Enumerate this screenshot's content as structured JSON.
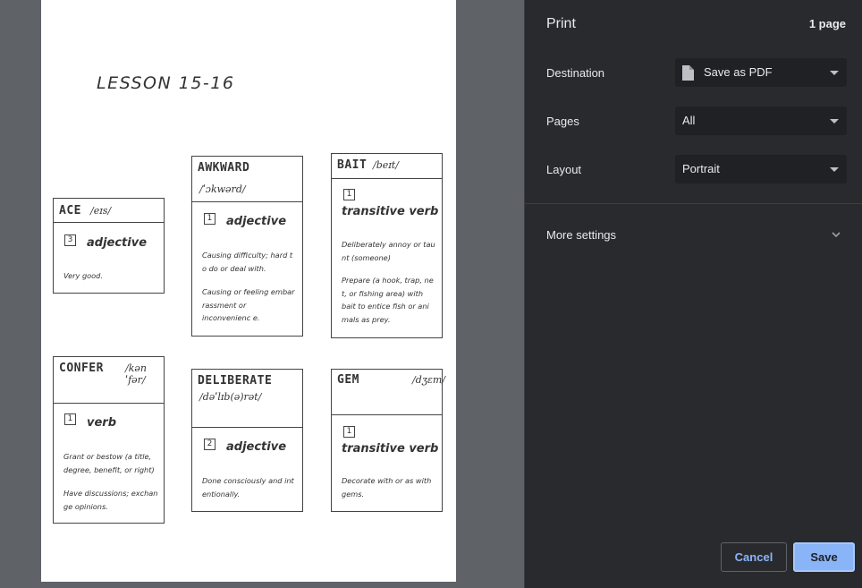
{
  "preview": {
    "lesson_title": "LESSON 15-16",
    "cards": [
      {
        "word": "ACE",
        "ipa": "/eɪs/",
        "number": "3",
        "part_of_speech": "adjective",
        "definitions": [
          "Very good."
        ]
      },
      {
        "word": "AWKWARD",
        "ipa": "/ˈɔkwərd/",
        "number": "1",
        "part_of_speech": "adjective",
        "definitions": [
          "Causing difficulty; hard t o do or deal with.",
          "Causing or feeling embar rassment or inconvenienc e."
        ]
      },
      {
        "word": "BAIT",
        "ipa": "/beɪt/",
        "number": "1",
        "part_of_speech": "transitive verb",
        "definitions": [
          "Deliberately annoy or tau nt (someone)",
          "Prepare (a hook, trap, ne t, or fishing area) with bait to entice fish or ani mals as prey."
        ]
      },
      {
        "word": "CONFER",
        "ipa": "/kənˈfər/",
        "number": "1",
        "part_of_speech": "verb",
        "definitions": [
          "Grant or bestow (a title, degree, benefit, or right)",
          "Have discussions; exchan ge opinions."
        ]
      },
      {
        "word": "DELIBERATE",
        "ipa": "/dəˈlɪb(ə)rət/",
        "number": "2",
        "part_of_speech": "adjective",
        "definitions": [
          "Done consciously and int entionally."
        ]
      },
      {
        "word": "GEM",
        "ipa": "/dʒɛm/",
        "number": "1",
        "part_of_speech": "transitive verb",
        "definitions": [
          "Decorate with or as with gems."
        ]
      }
    ]
  },
  "panel": {
    "title": "Print",
    "page_count": "1 page",
    "destination": {
      "label": "Destination",
      "value": "Save as PDF",
      "icon": "file-icon"
    },
    "pages": {
      "label": "Pages",
      "value": "All"
    },
    "layout": {
      "label": "Layout",
      "value": "Portrait"
    },
    "more_settings": "More settings",
    "cancel_label": "Cancel",
    "save_label": "Save"
  },
  "colors": {
    "panel_bg": "#292a2d",
    "select_bg": "#202124",
    "accent": "#8ab4f8",
    "preview_bg": "#5f6368"
  }
}
